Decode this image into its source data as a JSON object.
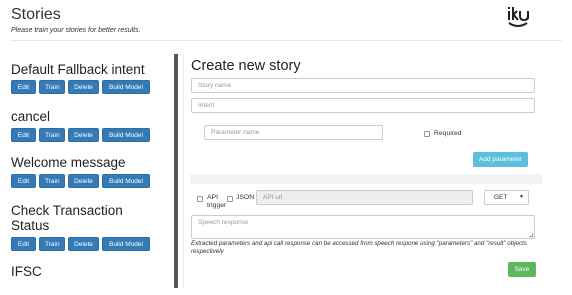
{
  "header": {
    "title": "Stories",
    "subtitle": "Please train your stories for better results."
  },
  "stories": [
    {
      "name": "Default Fallback intent"
    },
    {
      "name": "cancel"
    },
    {
      "name": "Welcome message"
    },
    {
      "name": "Check Transaction Status"
    },
    {
      "name": "IFSC"
    }
  ],
  "story_buttons": {
    "edit": "Edit",
    "train": "Train",
    "delete": "Delete",
    "build": "Build Model"
  },
  "form": {
    "title": "Create new story",
    "story_name_placeholder": "Story name",
    "intent_placeholder": "Intent",
    "parameter_name_placeholder": "Parameter name",
    "required_label": "Required",
    "add_parameter_label": "Add parameter",
    "api_trigger_label": "API trigger",
    "json_label": "JSON",
    "api_url_placeholder": "API url",
    "method_value": "GET",
    "speech_response_placeholder": "Speech response",
    "help_text": "Extracted parameters and api call response can be accessed from speech respone using \"parameters\" and \"result\" objects respectively",
    "save_label": "Save"
  },
  "colors": {
    "primary": "#337ab7",
    "info": "#5bc0de",
    "success": "#5cb85c"
  }
}
